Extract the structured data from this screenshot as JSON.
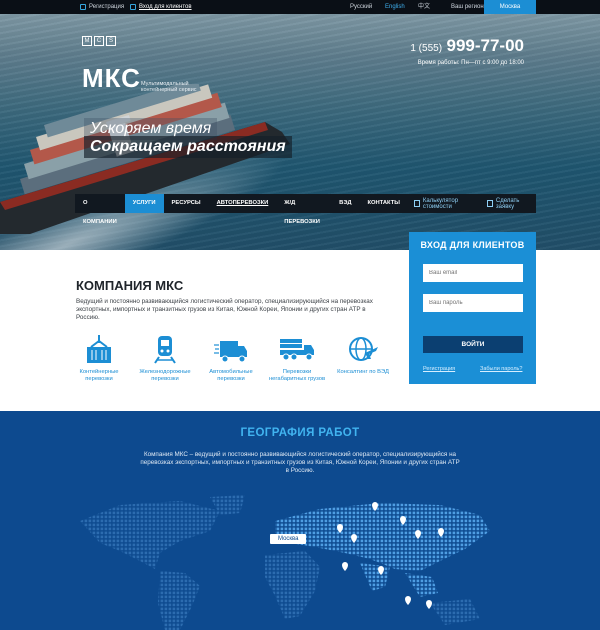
{
  "topbar": {
    "register": "Регистрация",
    "login": "Вход для клиентов",
    "lang_ru": "Русский",
    "lang_en": "English",
    "lang_cn": "中文",
    "region_label": "Ваш регион",
    "region_city": "Москва"
  },
  "header": {
    "logo_letters": [
      "M",
      "C",
      "S"
    ],
    "logo_name": "МКС",
    "logo_sub": "Мультимодальный контейнерный сервис",
    "phone_prefix": "1 (555)",
    "phone_number": "999-77-00",
    "hours": "Время работы: Пн—пт с 9:00 до 18:00",
    "slogan1": "Ускоряем время",
    "slogan2": "Сокращаем расстояния"
  },
  "nav": {
    "items": [
      "О компании",
      "Услуги",
      "Ресурсы",
      "Автоперевозки",
      "Ж/д перевозки",
      "ВЭД",
      "Контакты"
    ],
    "calc": "Калькулятор стоимости",
    "order": "Сделать заявку"
  },
  "login_box": {
    "title": "ВХОД ДЛЯ КЛИЕНТОВ",
    "email_placeholder": "Ваш email",
    "password_placeholder": "Ваш пароль",
    "submit": "ВОЙТИ",
    "register": "Регистрация",
    "forgot": "Забыли пароль?"
  },
  "about": {
    "title": "КОМПАНИЯ МКС",
    "text": "Ведущий и постоянно развивающийся логистический оператор, специализирующийся на перевозках экспортных, импортных и транзитных грузов из Китая, Южной Кореи, Японии и других стран АТР в Россию.",
    "services": [
      {
        "label": "Контейнерные перевозки",
        "icon": "container-icon"
      },
      {
        "label": "Железнодорожные перевозки",
        "icon": "train-icon"
      },
      {
        "label": "Автомобильные перевозки",
        "icon": "truck-icon"
      },
      {
        "label": "Перевозки негабаритных грузов",
        "icon": "oversize-truck-icon"
      },
      {
        "label": "Консалтинг по ВЭД",
        "icon": "globe-plane-icon"
      }
    ]
  },
  "geo": {
    "title": "ГЕОГРАФИЯ РАБОТ",
    "text": "Компания МКС – ведущий и постоянно развивающийся логистический оператор, специализирующийся на перевозках экспортных, импортных и транзитных грузов из Китая, Южной Кореи, Японии и других стран АТР в Россию.",
    "city_label": "Москва"
  },
  "colors": {
    "accent": "#1c8ed4",
    "dark": "#111820",
    "geo_bg": "#0d4a8f",
    "geo_title": "#41b4f0"
  }
}
